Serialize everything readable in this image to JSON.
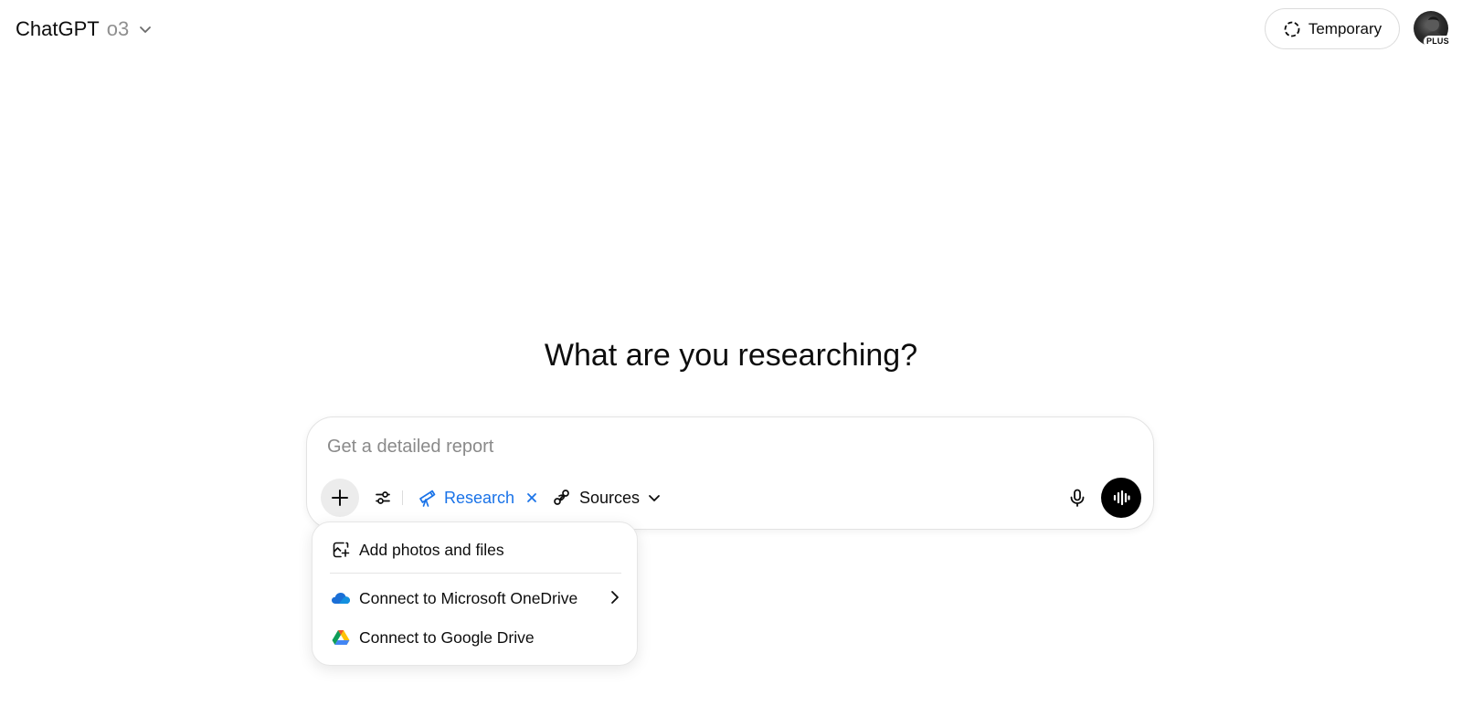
{
  "header": {
    "brand": "ChatGPT",
    "model": "o3",
    "temporary_label": "Temporary",
    "plan_badge": "PLUS"
  },
  "main": {
    "headline": "What are you researching?"
  },
  "composer": {
    "placeholder": "Get a detailed report",
    "value": "",
    "research_label": "Research",
    "sources_label": "Sources"
  },
  "attach_menu": {
    "items": [
      {
        "label": "Add photos and files",
        "icon": "add-file-icon"
      },
      {
        "label": "Connect to Microsoft OneDrive",
        "icon": "onedrive-icon",
        "has_submenu": true
      },
      {
        "label": "Connect to Google Drive",
        "icon": "google-drive-icon"
      }
    ]
  },
  "colors": {
    "accent_blue": "#1a73e8",
    "text": "#0d0d0d",
    "muted": "#8f8f8f",
    "voice_button": "#000000"
  }
}
